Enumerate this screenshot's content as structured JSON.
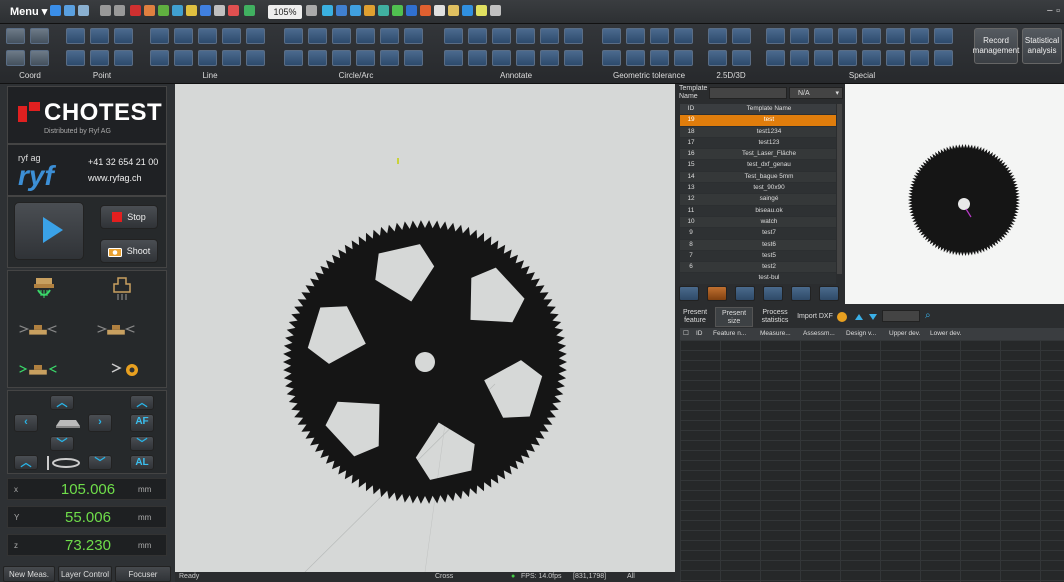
{
  "topbar": {
    "menu_label": "Menu ▾",
    "zoom_level": "105%",
    "window_controls": "− ▫"
  },
  "ribbon": {
    "groups": [
      "Coord",
      "Point",
      "Line",
      "Circle/Arc",
      "Annotate",
      "Geometric tolerance",
      "2.5D/3D",
      "Special"
    ],
    "record_management": "Record management",
    "statistical_analysis": "Statistical analysis"
  },
  "brand": {
    "logo_text": "CHOTEST",
    "logo_sub": "Distributed by Ryf AG",
    "ryf_small": "ryf ag",
    "ryf_big": "ryf",
    "phone": "+41 32 654 21 00",
    "website": "www.ryfag.ch"
  },
  "run": {
    "stop_label": "Stop",
    "shoot_label": "Shoot"
  },
  "motion": {
    "af_label": "AF",
    "al_label": "AL"
  },
  "coords": [
    {
      "axis": "x",
      "value": "105.006",
      "unit": "mm"
    },
    {
      "axis": "Y",
      "value": "55.006",
      "unit": "mm"
    },
    {
      "axis": "z",
      "value": "73.230",
      "unit": "mm"
    }
  ],
  "bottom_buttons": [
    "New Meas.",
    "Layer Control",
    "Focuser"
  ],
  "status": {
    "ready": "Ready",
    "cross": "Cross",
    "fps": "FPS: 14.0fps",
    "pos": "[831,1798]",
    "all": "All"
  },
  "template": {
    "name_label": "Template Name",
    "selector_value": "N/A",
    "col_id": "ID",
    "col_name": "Template Name",
    "rows": [
      {
        "id": "19",
        "name": "test"
      },
      {
        "id": "18",
        "name": "test1234"
      },
      {
        "id": "17",
        "name": "test123"
      },
      {
        "id": "16",
        "name": "Test_Laser_Fläche"
      },
      {
        "id": "15",
        "name": "test_dxf_genau"
      },
      {
        "id": "14",
        "name": "Test_bague 5mm"
      },
      {
        "id": "13",
        "name": "test_90x90"
      },
      {
        "id": "12",
        "name": "saingé"
      },
      {
        "id": "11",
        "name": "biseau.ok"
      },
      {
        "id": "10",
        "name": "watch"
      },
      {
        "id": "9",
        "name": "test7"
      },
      {
        "id": "8",
        "name": "test6"
      },
      {
        "id": "7",
        "name": "test5"
      },
      {
        "id": "6",
        "name": "test2"
      },
      {
        "id": "",
        "name": "test-bul"
      }
    ]
  },
  "features": {
    "tab_present_feature": "Present feature",
    "tab_present_size": "Present size",
    "tab_process_statistics": "Process statistics",
    "tab_import_dxf": "Import DXF",
    "columns": [
      "ID",
      "Feature n...",
      "Measure...",
      "Assessm...",
      "Design v...",
      "Upper dev.",
      "Lower dev."
    ]
  },
  "colors": {
    "accent_orange": "#e07d0c",
    "coord_green": "#6fdd4a",
    "play_blue": "#3aa2e8",
    "stop_red": "#e31f1f"
  }
}
